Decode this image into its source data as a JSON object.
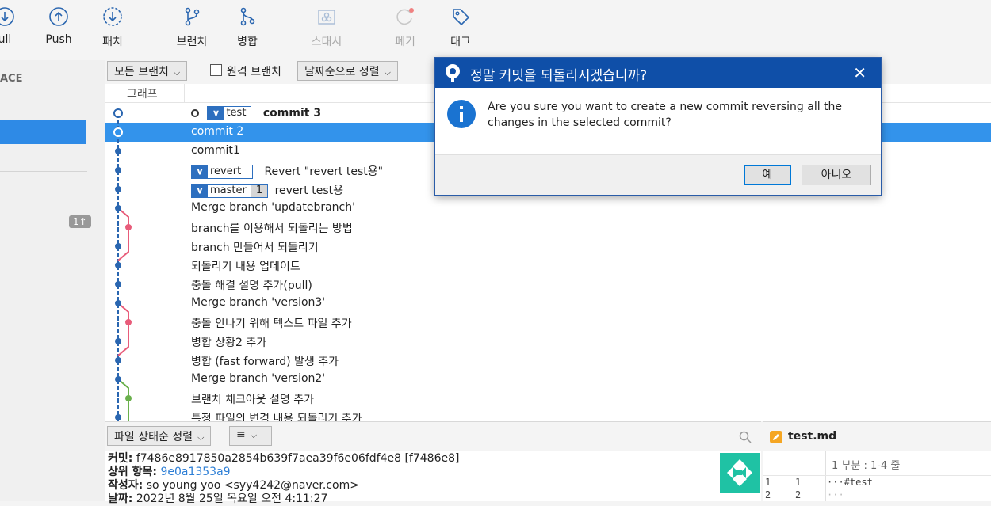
{
  "toolbar": {
    "pull": "ull",
    "push": "Push",
    "fetch": "패치",
    "branch": "브랜치",
    "merge": "병합",
    "stash": "스태시",
    "discard": "폐기",
    "tag": "태그"
  },
  "sidebar": {
    "workspace_heading": "ACE",
    "badge": "1↑"
  },
  "filter": {
    "branches_dropdown": "모든 브랜치",
    "remote_branches_label": "원격 브랜치",
    "sort_dropdown": "날짜순으로 정렬"
  },
  "list": {
    "graph_header": "그래프",
    "rows": [
      {
        "message": "commit 3",
        "tag": "test"
      },
      {
        "message": "commit 2"
      },
      {
        "message": "commit1"
      },
      {
        "message": "Revert \"revert test용\"",
        "tag": "revert"
      },
      {
        "message": "revert test용",
        "tag": "master",
        "count": "1"
      },
      {
        "message": "Merge branch 'updatebranch'"
      },
      {
        "message": "branch를 이용해서 되돌리는 방법"
      },
      {
        "message": "branch 만들어서 되돌리기"
      },
      {
        "message": "되돌리기 내용 업데이트"
      },
      {
        "message": "충돌 해결 설명 추가(pull)"
      },
      {
        "message": "Merge branch 'version3'"
      },
      {
        "message": "충돌 안나기 위해 텍스트 파일 추가"
      },
      {
        "message": "병합 상황2 추가"
      },
      {
        "message": "병합 (fast forward) 발생 추가"
      },
      {
        "message": "Merge branch 'version2'"
      },
      {
        "message": "브랜치 체크아웃 설명 추가"
      },
      {
        "message": "특정 파일의 변경 내용 되돌리기 추가"
      }
    ]
  },
  "bottom": {
    "file_sort_dropdown": "파일 상태순 정렬",
    "view_menu": "≡"
  },
  "details": {
    "commit_label": "커밋:",
    "commit_value": "f7486e8917850a2854b639f7aea39f6e06fdf4e8 [f7486e8]",
    "parent_label": "상위 항목:",
    "parent_value": "9e0a1353a9",
    "author_label": "작성자:",
    "author_value": "so young yoo <syy4242@naver.com>",
    "date_label": "날짜:",
    "date_value": "2022년 8월 25일 목요일 오전 4:11:27"
  },
  "diff": {
    "file_name": "test.md",
    "hunk_header": "1 부분 : 1-4 줄",
    "lines": [
      {
        "old": "1",
        "new": "1",
        "text": "···#test"
      },
      {
        "old": "2",
        "new": "2",
        "text": "···"
      }
    ]
  },
  "dialog": {
    "title": "정말 커밋을 되돌리시겠습니까?",
    "message": "Are you sure you want to create a new commit reversing all the changes in the selected commit?",
    "yes": "예",
    "no": "아니오"
  },
  "colors": {
    "accent": "#3393eb",
    "dialog_title": "#0f4fa8",
    "graph_blue": "#2a66b0",
    "graph_red": "#e85c7a",
    "graph_green": "#6ab04c"
  }
}
